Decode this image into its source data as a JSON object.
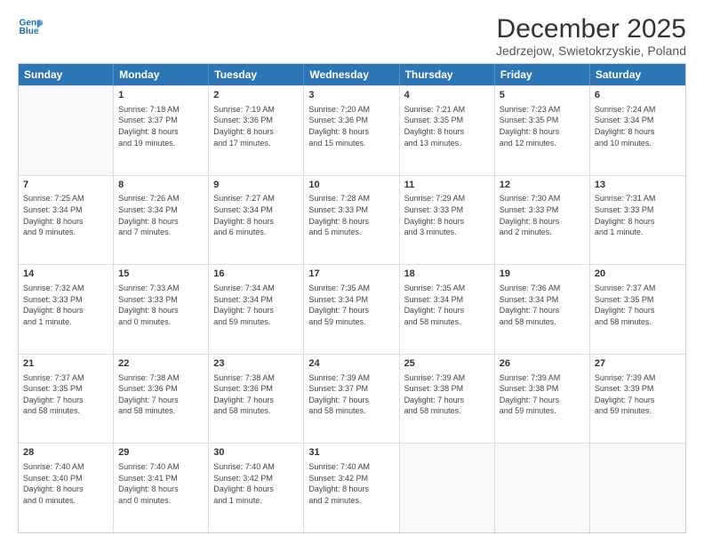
{
  "logo": {
    "line1": "General",
    "line2": "Blue"
  },
  "title": "December 2025",
  "subtitle": "Jedrzejow, Swietokrzyskie, Poland",
  "header_days": [
    "Sunday",
    "Monday",
    "Tuesday",
    "Wednesday",
    "Thursday",
    "Friday",
    "Saturday"
  ],
  "weeks": [
    [
      {
        "day": "",
        "info": ""
      },
      {
        "day": "1",
        "info": "Sunrise: 7:18 AM\nSunset: 3:37 PM\nDaylight: 8 hours\nand 19 minutes."
      },
      {
        "day": "2",
        "info": "Sunrise: 7:19 AM\nSunset: 3:36 PM\nDaylight: 8 hours\nand 17 minutes."
      },
      {
        "day": "3",
        "info": "Sunrise: 7:20 AM\nSunset: 3:36 PM\nDaylight: 8 hours\nand 15 minutes."
      },
      {
        "day": "4",
        "info": "Sunrise: 7:21 AM\nSunset: 3:35 PM\nDaylight: 8 hours\nand 13 minutes."
      },
      {
        "day": "5",
        "info": "Sunrise: 7:23 AM\nSunset: 3:35 PM\nDaylight: 8 hours\nand 12 minutes."
      },
      {
        "day": "6",
        "info": "Sunrise: 7:24 AM\nSunset: 3:34 PM\nDaylight: 8 hours\nand 10 minutes."
      }
    ],
    [
      {
        "day": "7",
        "info": "Sunrise: 7:25 AM\nSunset: 3:34 PM\nDaylight: 8 hours\nand 9 minutes."
      },
      {
        "day": "8",
        "info": "Sunrise: 7:26 AM\nSunset: 3:34 PM\nDaylight: 8 hours\nand 7 minutes."
      },
      {
        "day": "9",
        "info": "Sunrise: 7:27 AM\nSunset: 3:34 PM\nDaylight: 8 hours\nand 6 minutes."
      },
      {
        "day": "10",
        "info": "Sunrise: 7:28 AM\nSunset: 3:33 PM\nDaylight: 8 hours\nand 5 minutes."
      },
      {
        "day": "11",
        "info": "Sunrise: 7:29 AM\nSunset: 3:33 PM\nDaylight: 8 hours\nand 3 minutes."
      },
      {
        "day": "12",
        "info": "Sunrise: 7:30 AM\nSunset: 3:33 PM\nDaylight: 8 hours\nand 2 minutes."
      },
      {
        "day": "13",
        "info": "Sunrise: 7:31 AM\nSunset: 3:33 PM\nDaylight: 8 hours\nand 1 minute."
      }
    ],
    [
      {
        "day": "14",
        "info": "Sunrise: 7:32 AM\nSunset: 3:33 PM\nDaylight: 8 hours\nand 1 minute."
      },
      {
        "day": "15",
        "info": "Sunrise: 7:33 AM\nSunset: 3:33 PM\nDaylight: 8 hours\nand 0 minutes."
      },
      {
        "day": "16",
        "info": "Sunrise: 7:34 AM\nSunset: 3:34 PM\nDaylight: 7 hours\nand 59 minutes."
      },
      {
        "day": "17",
        "info": "Sunrise: 7:35 AM\nSunset: 3:34 PM\nDaylight: 7 hours\nand 59 minutes."
      },
      {
        "day": "18",
        "info": "Sunrise: 7:35 AM\nSunset: 3:34 PM\nDaylight: 7 hours\nand 58 minutes."
      },
      {
        "day": "19",
        "info": "Sunrise: 7:36 AM\nSunset: 3:34 PM\nDaylight: 7 hours\nand 58 minutes."
      },
      {
        "day": "20",
        "info": "Sunrise: 7:37 AM\nSunset: 3:35 PM\nDaylight: 7 hours\nand 58 minutes."
      }
    ],
    [
      {
        "day": "21",
        "info": "Sunrise: 7:37 AM\nSunset: 3:35 PM\nDaylight: 7 hours\nand 58 minutes."
      },
      {
        "day": "22",
        "info": "Sunrise: 7:38 AM\nSunset: 3:36 PM\nDaylight: 7 hours\nand 58 minutes."
      },
      {
        "day": "23",
        "info": "Sunrise: 7:38 AM\nSunset: 3:36 PM\nDaylight: 7 hours\nand 58 minutes."
      },
      {
        "day": "24",
        "info": "Sunrise: 7:39 AM\nSunset: 3:37 PM\nDaylight: 7 hours\nand 58 minutes."
      },
      {
        "day": "25",
        "info": "Sunrise: 7:39 AM\nSunset: 3:38 PM\nDaylight: 7 hours\nand 58 minutes."
      },
      {
        "day": "26",
        "info": "Sunrise: 7:39 AM\nSunset: 3:38 PM\nDaylight: 7 hours\nand 59 minutes."
      },
      {
        "day": "27",
        "info": "Sunrise: 7:39 AM\nSunset: 3:39 PM\nDaylight: 7 hours\nand 59 minutes."
      }
    ],
    [
      {
        "day": "28",
        "info": "Sunrise: 7:40 AM\nSunset: 3:40 PM\nDaylight: 8 hours\nand 0 minutes."
      },
      {
        "day": "29",
        "info": "Sunrise: 7:40 AM\nSunset: 3:41 PM\nDaylight: 8 hours\nand 0 minutes."
      },
      {
        "day": "30",
        "info": "Sunrise: 7:40 AM\nSunset: 3:42 PM\nDaylight: 8 hours\nand 1 minute."
      },
      {
        "day": "31",
        "info": "Sunrise: 7:40 AM\nSunset: 3:42 PM\nDaylight: 8 hours\nand 2 minutes."
      },
      {
        "day": "",
        "info": ""
      },
      {
        "day": "",
        "info": ""
      },
      {
        "day": "",
        "info": ""
      }
    ]
  ]
}
